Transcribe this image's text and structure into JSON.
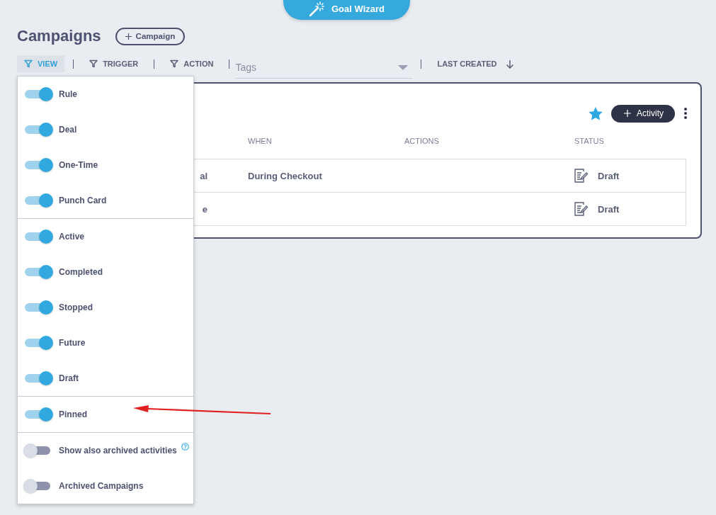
{
  "wizard_button": {
    "label": "Goal Wizard"
  },
  "page_title": "Campaigns",
  "add_campaign_button": {
    "label": "Campaign"
  },
  "filters": [
    {
      "label": "VIEW",
      "selected": true
    },
    {
      "label": "TRIGGER",
      "selected": false
    },
    {
      "label": "ACTION",
      "selected": false
    }
  ],
  "tags_field": {
    "placeholder": "Tags"
  },
  "sort": {
    "label": "LAST CREATED"
  },
  "view_menu": {
    "groups": [
      {
        "items": [
          {
            "label": "Rule",
            "on": true,
            "kind": "toggle"
          },
          {
            "label": "Deal",
            "on": true,
            "kind": "toggle"
          },
          {
            "label": "One-Time",
            "on": true,
            "kind": "toggle"
          },
          {
            "label": "Punch Card",
            "on": true,
            "kind": "toggle"
          }
        ]
      },
      {
        "items": [
          {
            "label": "Active",
            "on": true,
            "kind": "toggle"
          },
          {
            "label": "Completed",
            "on": true,
            "kind": "toggle"
          },
          {
            "label": "Stopped",
            "on": true,
            "kind": "toggle"
          },
          {
            "label": "Future",
            "on": true,
            "kind": "toggle"
          },
          {
            "label": "Draft",
            "on": true,
            "kind": "toggle"
          }
        ]
      },
      {
        "items": [
          {
            "label": "Pinned",
            "on": true,
            "kind": "toggle"
          }
        ]
      },
      {
        "items": [
          {
            "label": "Show also archived activities",
            "on": false,
            "kind": "toggle_with_help"
          },
          {
            "label": "Archived Campaigns",
            "on": false,
            "kind": "toggle"
          }
        ]
      }
    ]
  },
  "campaign_card": {
    "pinned": true,
    "add_activity_button": {
      "label": "Activity"
    },
    "table": {
      "columns": [
        "WHEN",
        "ACTIONS",
        "STATUS"
      ],
      "rows": [
        {
          "column_1": "al",
          "when": "During Checkout",
          "status": "Draft"
        },
        {
          "column_1": "e",
          "status": "Draft"
        }
      ]
    }
  }
}
